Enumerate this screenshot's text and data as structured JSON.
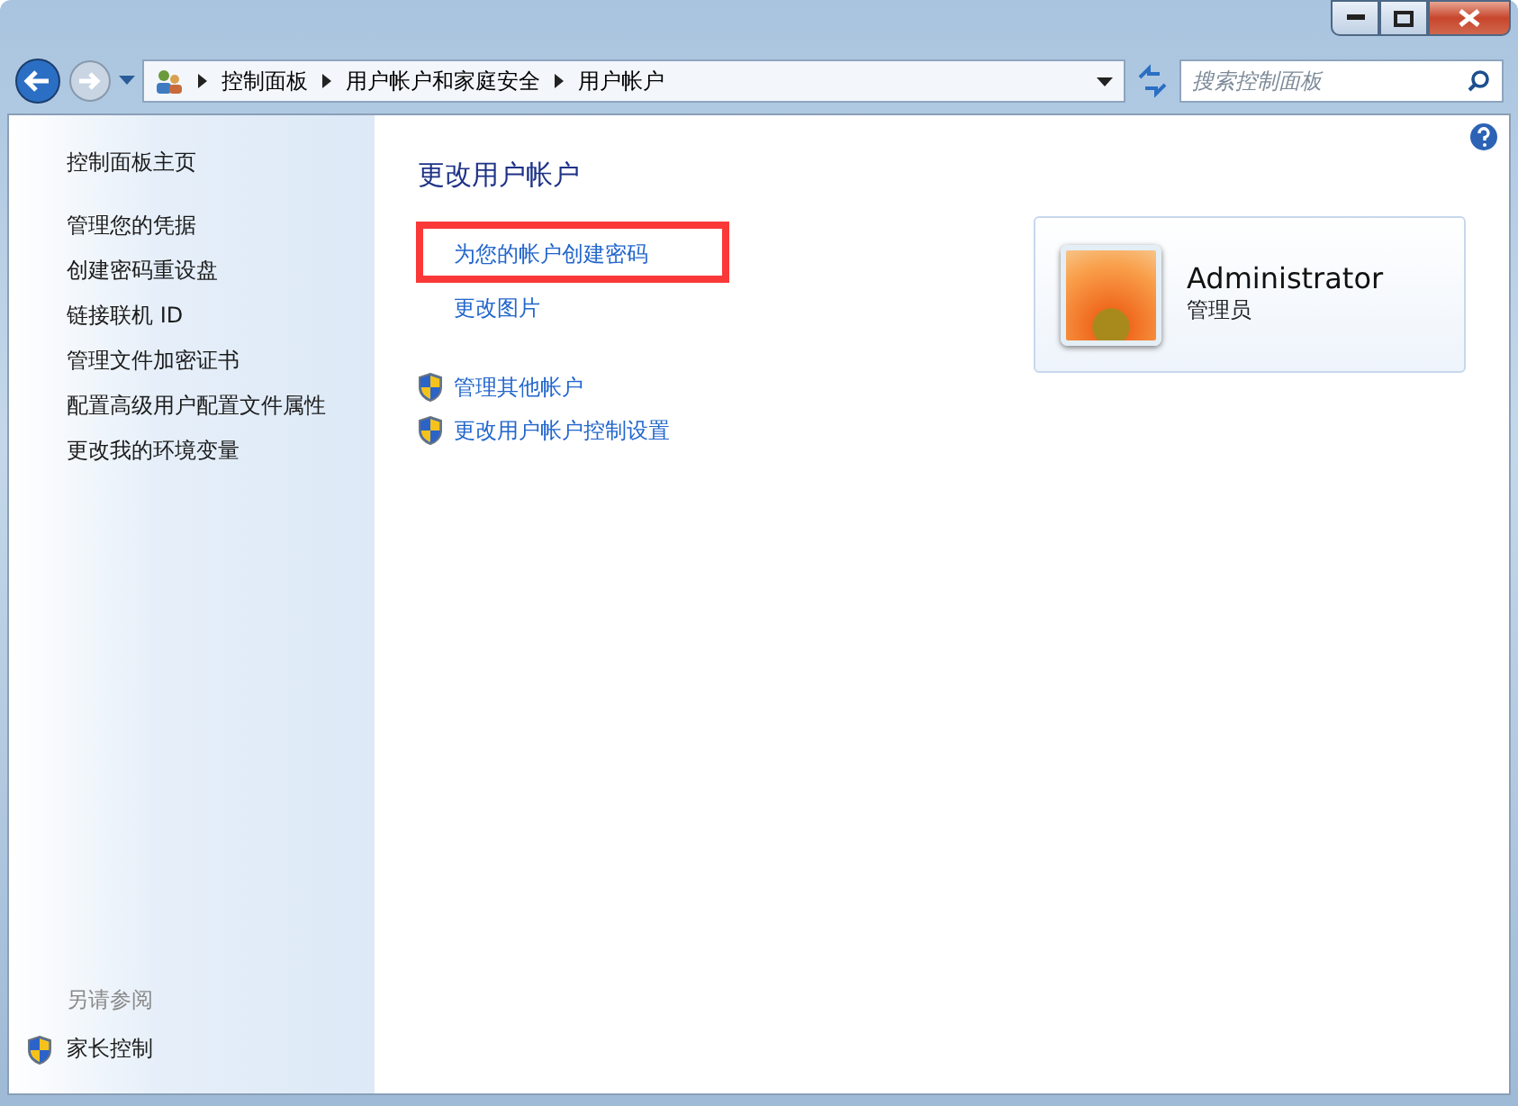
{
  "address_bar": {
    "breadcrumbs": [
      "控制面板",
      "用户帐户和家庭安全",
      "用户帐户"
    ]
  },
  "search": {
    "placeholder": "搜索控制面板"
  },
  "sidebar": {
    "items": [
      "控制面板主页",
      "管理您的凭据",
      "创建密码重设盘",
      "链接联机 ID",
      "管理文件加密证书",
      "配置高级用户配置文件属性",
      "更改我的环境变量"
    ],
    "see_also": {
      "heading": "另请参阅",
      "items": [
        {
          "label": "家长控制",
          "kind": "shield"
        }
      ]
    }
  },
  "main": {
    "title": "更改用户帐户",
    "tasks": [
      {
        "label": "为您的帐户创建密码",
        "kind": "link",
        "highlighted": true
      },
      {
        "label": "更改图片",
        "kind": "link",
        "highlighted": false
      },
      {
        "label": "管理其他帐户",
        "kind": "shield",
        "highlighted": false
      },
      {
        "label": "更改用户帐户控制设置",
        "kind": "shield",
        "highlighted": false
      }
    ],
    "account": {
      "name": "Administrator",
      "role": "管理员"
    }
  }
}
